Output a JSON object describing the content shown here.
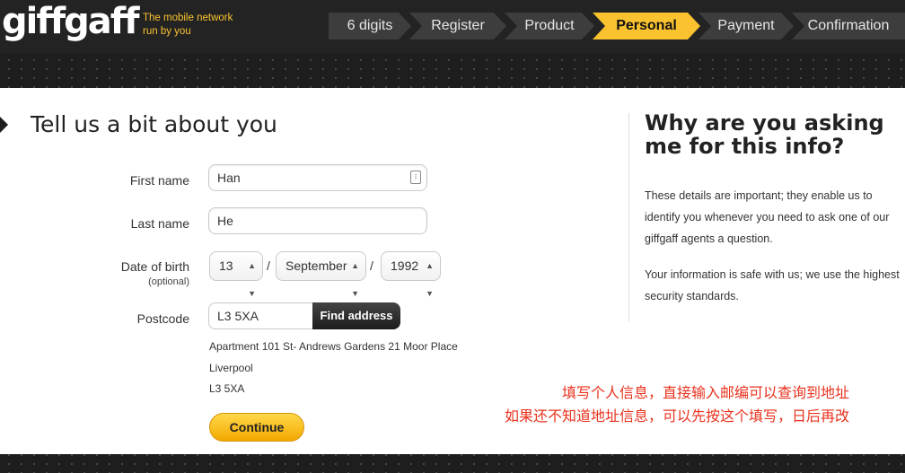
{
  "header": {
    "logo": "giffgaff",
    "tagline_line1": "The mobile network",
    "tagline_line2": "run by you",
    "steps": [
      {
        "label": "6 digits"
      },
      {
        "label": "Register"
      },
      {
        "label": "Product"
      },
      {
        "label": "Personal",
        "active": true
      },
      {
        "label": "Payment"
      },
      {
        "label": "Confirmation"
      }
    ]
  },
  "form": {
    "title": "Tell us a bit about you",
    "first_name_label": "First name",
    "first_name_value": "Han",
    "last_name_label": "Last name",
    "last_name_value": "He",
    "dob_label": "Date of birth",
    "dob_optional": "(optional)",
    "dob_day": "13",
    "dob_month": "September",
    "dob_year": "1992",
    "dob_separator": "/",
    "postcode_label": "Postcode",
    "postcode_value": "L3 5XA",
    "find_address_label": "Find address",
    "address_lines": [
      "Apartment 101 St- Andrews Gardens 21 Moor Place",
      "Liverpool",
      "L3 5XA"
    ],
    "continue_label": "Continue"
  },
  "sidebar": {
    "title": "Why are you asking me for this info?",
    "para1": "These details are important; they enable us to identify you whenever you need to ask one of our giffgaff agents a question.",
    "para2": "Your information is safe with us; we use the highest security standards."
  },
  "annotation": {
    "line1": "填写个人信息，直接输入邮编可以查询到地址",
    "line2": "如果还不知道地址信息，可以先按这个填写，日后再改"
  },
  "colors": {
    "accent": "#f9c22e",
    "background": "#1e1e1e",
    "note": "#e8321e"
  }
}
